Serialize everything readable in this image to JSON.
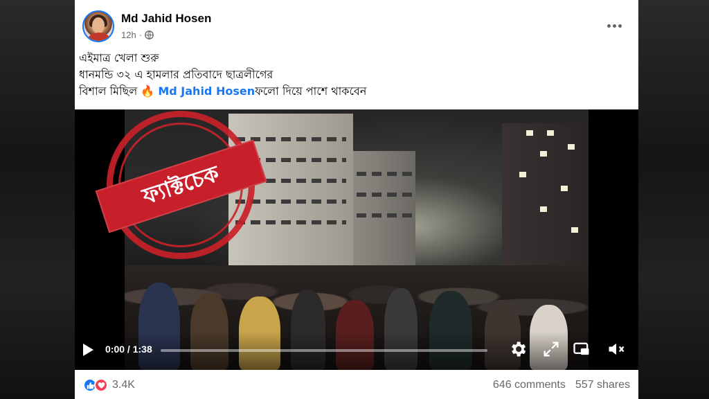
{
  "post": {
    "author": "Md Jahid Hosen",
    "time": "12h",
    "privacy_icon": "globe-icon",
    "text_line1": "এইমাত্র  খেলা শুরু",
    "text_line2": "ধানমন্ডি ৩২ এ হামলার প্রতিবাদে ছাত্রলীগের",
    "text_line3_before": "বিশাল মিছিল ",
    "fire_emoji": "🔥",
    "mention": "Md Jahid Hosen",
    "text_line3_after": "ফলো দিয়ে পাশে থাকবেন"
  },
  "video": {
    "stamp_text": "ফ্যাক্টচেক",
    "time_current": "0:00",
    "time_separator": "/",
    "time_total": "1:38",
    "progress": 0.0
  },
  "footer": {
    "reaction_count": "3.4K",
    "comments": "646 comments",
    "shares": "557 shares"
  },
  "colors": {
    "accent": "#1877f2",
    "stamp_red": "#c8202a",
    "love": "#f33e58"
  }
}
